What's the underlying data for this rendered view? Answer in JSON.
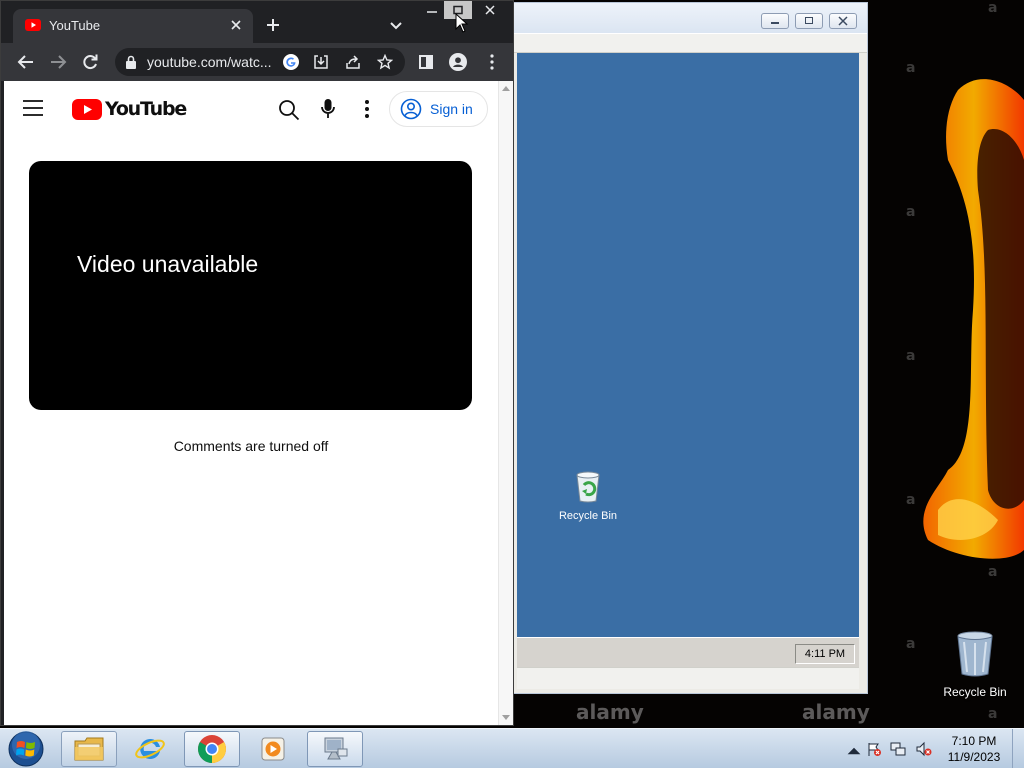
{
  "chrome": {
    "tab_title": "YouTube",
    "url": "youtube.com/watc..."
  },
  "youtube": {
    "logo_text": "YouTube",
    "signin_label": "Sign in",
    "video_message": "Video unavailable",
    "comments_message": "Comments are turned off"
  },
  "remote": {
    "clock": "4:11 PM",
    "recycle_bin_label": "Recycle Bin"
  },
  "desktop": {
    "recycle_bin_label": "Recycle Bin",
    "watermark_text": "alamy",
    "watermark_letter": "a"
  },
  "taskbar": {
    "time": "7:10 PM",
    "date": "11/9/2023",
    "apps": [
      "windows-explorer",
      "internet-explorer",
      "google-chrome",
      "media-player",
      "remote-desktop"
    ]
  },
  "colors": {
    "youtube_red": "#ff0000",
    "signin_blue": "#065fd4",
    "chrome_dark": "#202124",
    "remote_desktop_blue": "#3a6ea5"
  }
}
